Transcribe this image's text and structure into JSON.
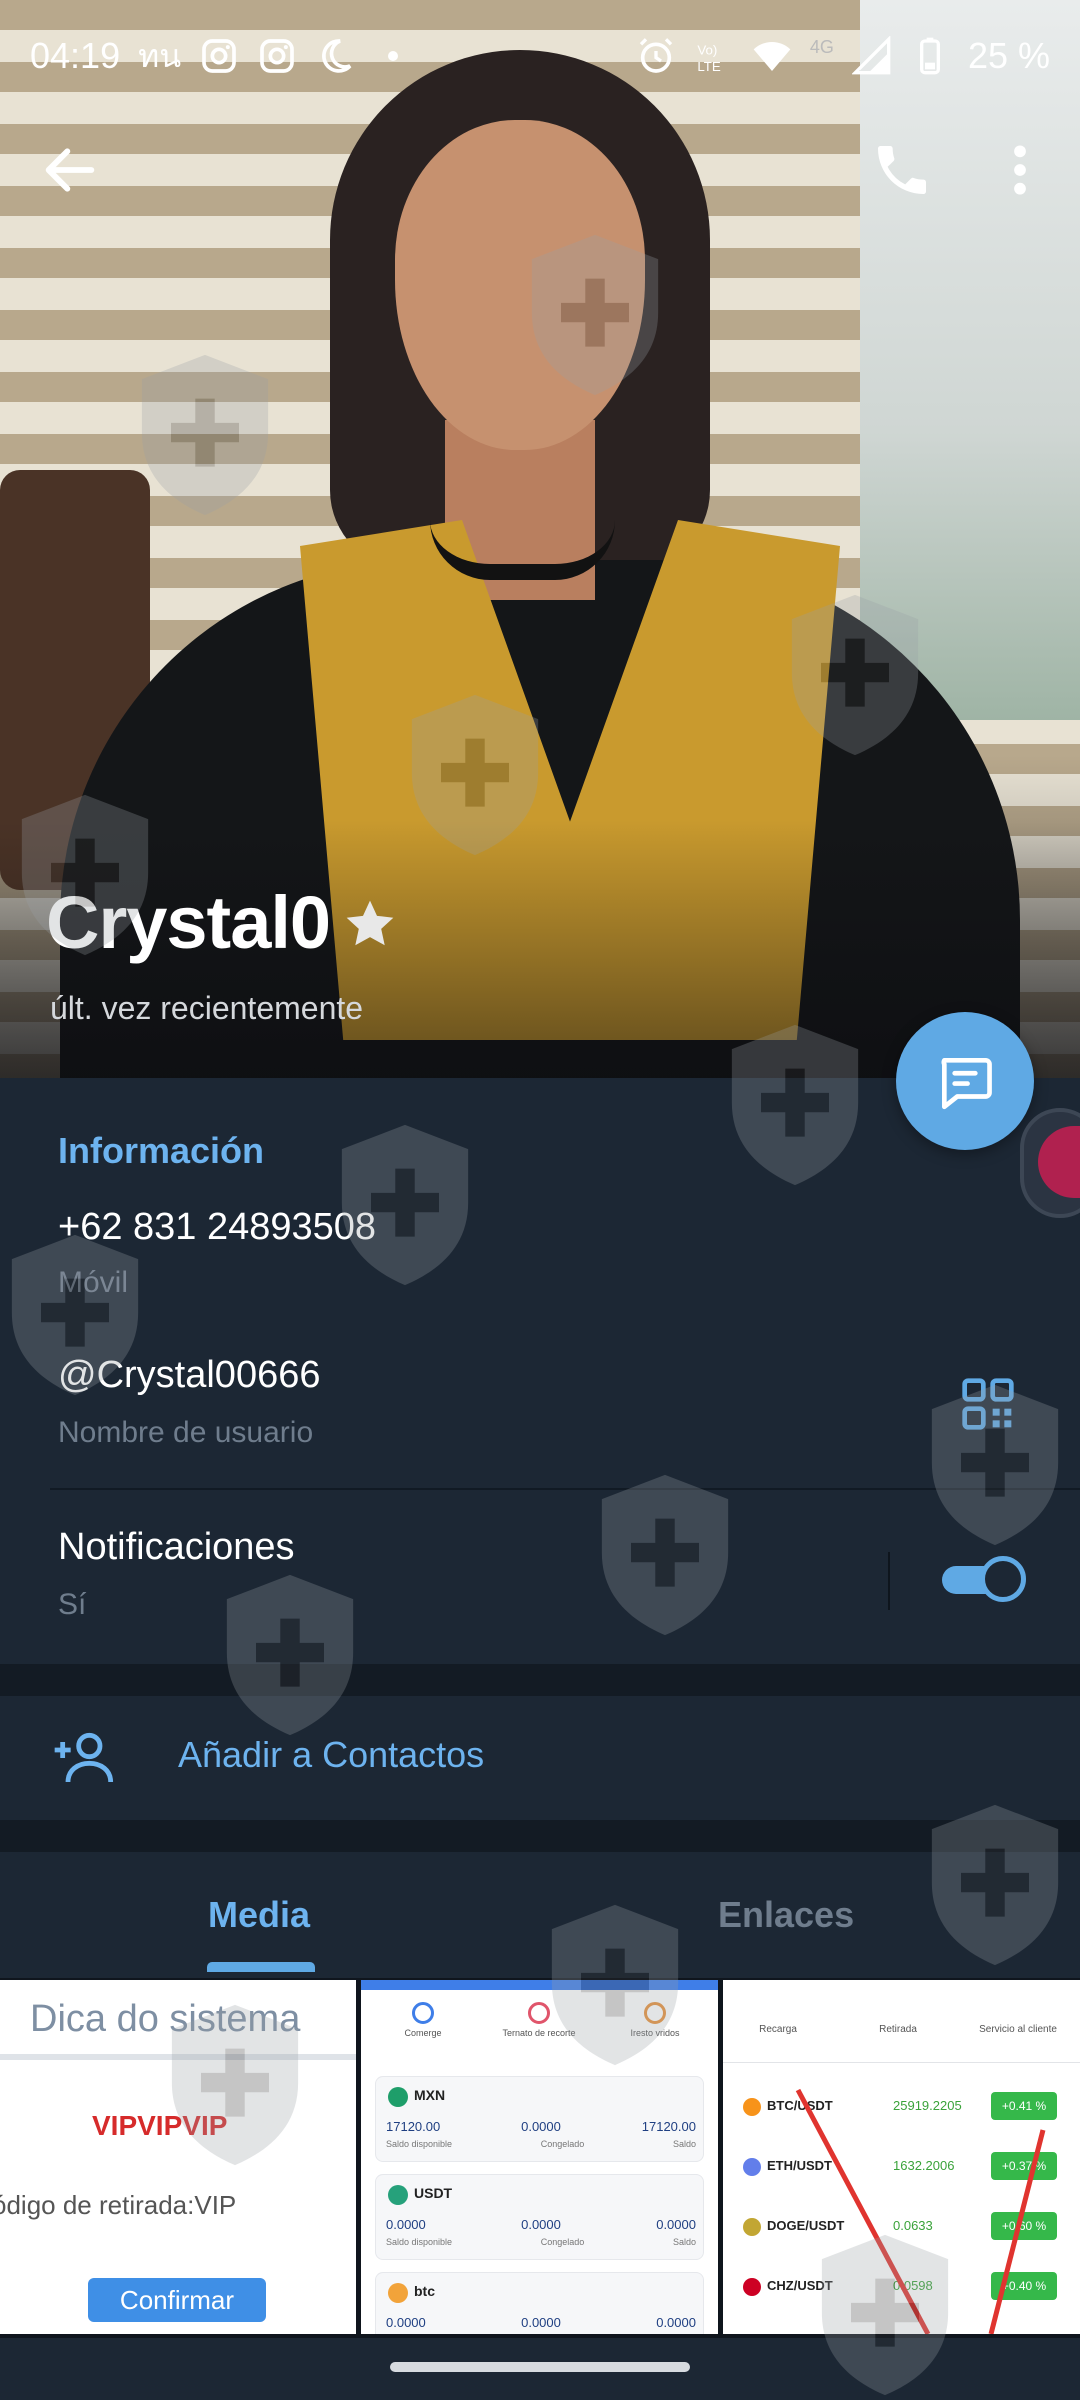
{
  "status_bar": {
    "time": "04:19",
    "carrier_glyph": "ทน",
    "network_label": "4G",
    "battery": "25 %",
    "icons": [
      "instagram-icon",
      "instagram-icon",
      "moon-icon",
      "dot-icon",
      "alarm-icon",
      "volte-icon",
      "wifi-icon",
      "signal-icon",
      "battery-icon"
    ]
  },
  "header": {
    "name": "Crystal0",
    "last_seen": "últ. vez recientemente",
    "icons": [
      "back-arrow-icon",
      "phone-icon",
      "more-vertical-icon",
      "star-icon",
      "message-icon"
    ]
  },
  "info": {
    "section_title": "Información",
    "phone": "+62 831 24893508",
    "phone_label": "Móvil",
    "username": "@Crystal00666",
    "username_label": "Nombre de usuario",
    "notifications_label": "Notificaciones",
    "notifications_value": "Sí",
    "notifications_enabled": true
  },
  "actions": {
    "add_contact": "Añadir a Contactos"
  },
  "tabs": [
    {
      "label": "Media",
      "active": true
    },
    {
      "label": "Enlaces",
      "active": false
    }
  ],
  "media": {
    "thumb1": {
      "title": "Dica do sistema",
      "vip": "VIPVIPVIP",
      "code": "ódigo de retirada:VIP",
      "button": "Confirmar"
    },
    "thumb2": {
      "nav": [
        "Comerge",
        "Ternato de recorte",
        "Iresto vridos"
      ],
      "cards": [
        {
          "name": "MXN",
          "vals": [
            "17120.00",
            "0.0000",
            "17120.00"
          ],
          "subs": [
            "Saldo disponible",
            "Congelado",
            "Saldo"
          ]
        },
        {
          "name": "USDT",
          "vals": [
            "0.0000",
            "0.0000",
            "0.0000"
          ],
          "subs": [
            "Saldo disponible",
            "Congelado",
            "Saldo"
          ]
        },
        {
          "name": "btc",
          "vals": [
            "0.0000",
            "0.0000",
            "0.0000"
          ],
          "subs": [
            "",
            "",
            ""
          ]
        }
      ]
    },
    "thumb3": {
      "nav": [
        "Recarga",
        "Retirada",
        "Servicio al cliente"
      ],
      "rows": [
        {
          "name": "BTC/USDT",
          "price": "25919.2205",
          "change": "+0.41 %"
        },
        {
          "name": "ETH/USDT",
          "price": "1632.2006",
          "change": "+0.37 %"
        },
        {
          "name": "DOGE/USDT",
          "price": "0.0633",
          "change": "+0.60 %"
        },
        {
          "name": "CHZ/USDT",
          "price": "0.0598",
          "change": "+0.40 %"
        }
      ]
    }
  },
  "colors": {
    "background": "#1c2734",
    "accent": "#5fa9e4",
    "link": "#6db3ef",
    "muted": "#6f7d8d"
  }
}
